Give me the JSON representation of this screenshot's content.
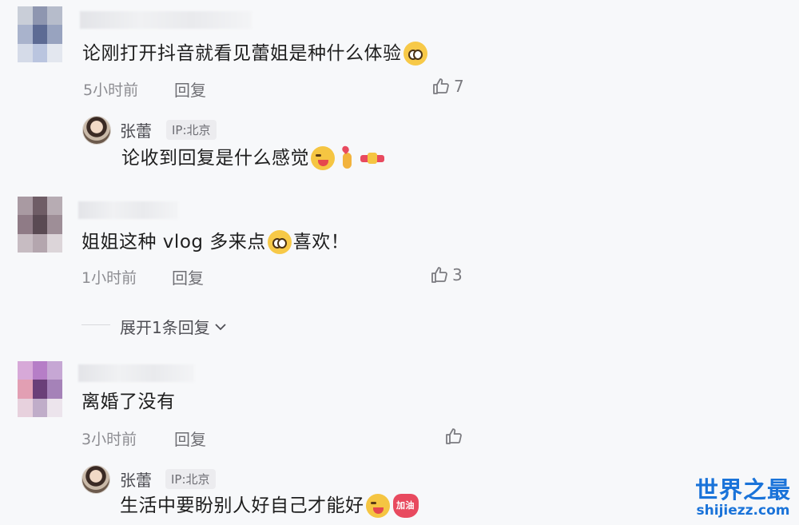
{
  "comments": [
    {
      "text": "论刚打开抖音就看见蕾姐是种什么体验",
      "time": "5小时前",
      "reply_label": "回复",
      "likes": "7",
      "reply": {
        "author": "张蕾",
        "ip": "IP:北京",
        "text": "论收到回复是什么感觉"
      }
    },
    {
      "text_before": "姐姐这种 vlog 多来点",
      "text_after": "喜欢！",
      "time": "1小时前",
      "reply_label": "回复",
      "likes": "3",
      "expand_label": "展开1条回复"
    },
    {
      "text": "离婚了没有",
      "time": "3小时前",
      "reply_label": "回复",
      "likes": "",
      "reply": {
        "author": "张蕾",
        "ip": "IP:北京",
        "text": "生活中要盼别人好自己才能好"
      }
    }
  ],
  "emoji_jiayou_label": "加油",
  "watermark": {
    "main": "世界之最",
    "sub": "shijiezz.com"
  },
  "colors": {
    "background": "#f7f8fa",
    "text": "#1e1e1e",
    "meta": "#8c8c91",
    "watermark": "#1a73d9"
  }
}
